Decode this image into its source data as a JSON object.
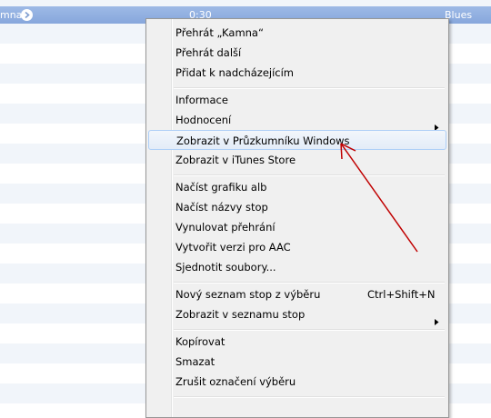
{
  "track_list": {
    "selected_row": {
      "name_fragment": "mna",
      "time": "0:30",
      "genre": "Blues"
    }
  },
  "context_menu": {
    "items": [
      {
        "label": "Přehrát „Kamna“"
      },
      {
        "label": "Přehrát další"
      },
      {
        "label": "Přidat k nadcházejícím"
      },
      {
        "label": "Informace"
      },
      {
        "label": "Hodnocení",
        "submenu": true
      },
      {
        "label": "Zobrazit v Průzkumníku Windows",
        "highlighted": true
      },
      {
        "label": "Zobrazit v iTunes Store"
      },
      {
        "label": "Načíst grafiku alb"
      },
      {
        "label": "Načíst názvy stop"
      },
      {
        "label": "Vynulovat přehrání"
      },
      {
        "label": "Vytvořit verzi pro AAC"
      },
      {
        "label": "Sjednotit soubory..."
      },
      {
        "label": "Nový seznam stop z výběru",
        "shortcut": "Ctrl+Shift+N"
      },
      {
        "label": "Zobrazit v seznamu stop",
        "submenu": true
      },
      {
        "label": "Kopírovat"
      },
      {
        "label": "Smazat"
      },
      {
        "label": "Zrušit označení výběru"
      }
    ]
  },
  "colors": {
    "selection_row": "#87a7dc",
    "menu_background": "#f0f0f0",
    "menu_highlight_border": "#aecff7",
    "annotation_arrow": "#c00000"
  },
  "icons": {
    "row_arrow": "circled-right-arrow-icon",
    "submenu": "triangle-right-icon"
  }
}
